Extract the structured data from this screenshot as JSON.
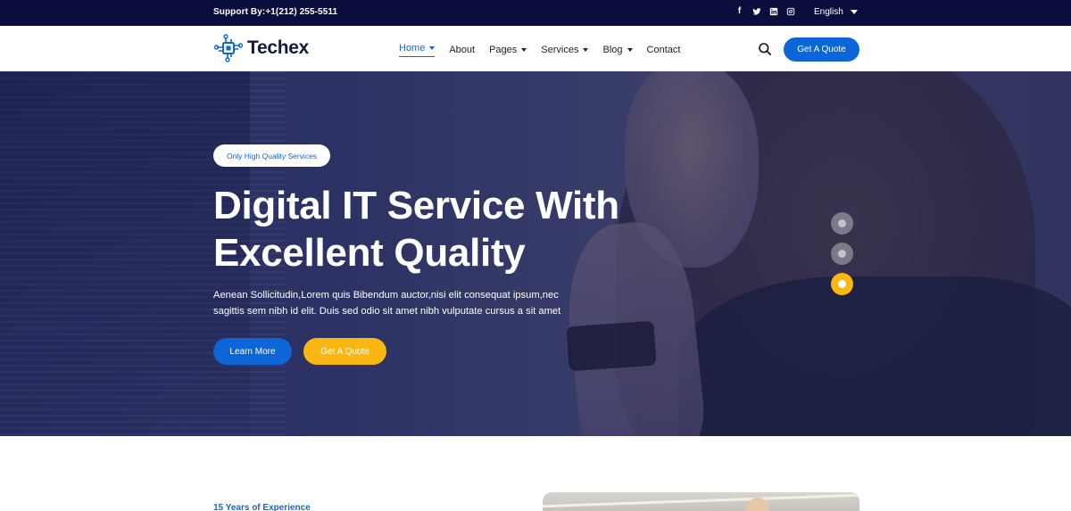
{
  "topbar": {
    "support": "Support By:+1(212) 255-5511",
    "socials": [
      "facebook-icon",
      "twitter-icon",
      "linkedin-icon",
      "instagram-icon"
    ],
    "language": "English"
  },
  "nav": {
    "brand": "Techex",
    "items": [
      {
        "label": "Home",
        "dropdown": true,
        "active": true
      },
      {
        "label": "About",
        "dropdown": false
      },
      {
        "label": "Pages",
        "dropdown": true
      },
      {
        "label": "Services",
        "dropdown": true
      },
      {
        "label": "Blog",
        "dropdown": true
      },
      {
        "label": "Contact",
        "dropdown": false
      }
    ],
    "cta": "Get A Quote"
  },
  "hero": {
    "badge": "Only High Quality Services",
    "title_line1": "Digital IT Service With",
    "title_line2": "Excellent Quality",
    "text_line1": "Aenean Sollicitudin,Lorem quis Bibendum auctor,nisi elit consequat ipsum,nec",
    "text_line2": "sagittis sem nibh id elit. Duis sed odio sit amet nibh vulputate cursus a sit amet",
    "btn_learn": "Learn More",
    "btn_quote": "Get A Quote",
    "slides": 3,
    "active_slide": 3
  },
  "about": {
    "eyebrow": "15 Years of Experience"
  },
  "colors": {
    "topbar": "#0b0e3d",
    "primary": "#0c66d8",
    "accent": "#f9b712"
  }
}
